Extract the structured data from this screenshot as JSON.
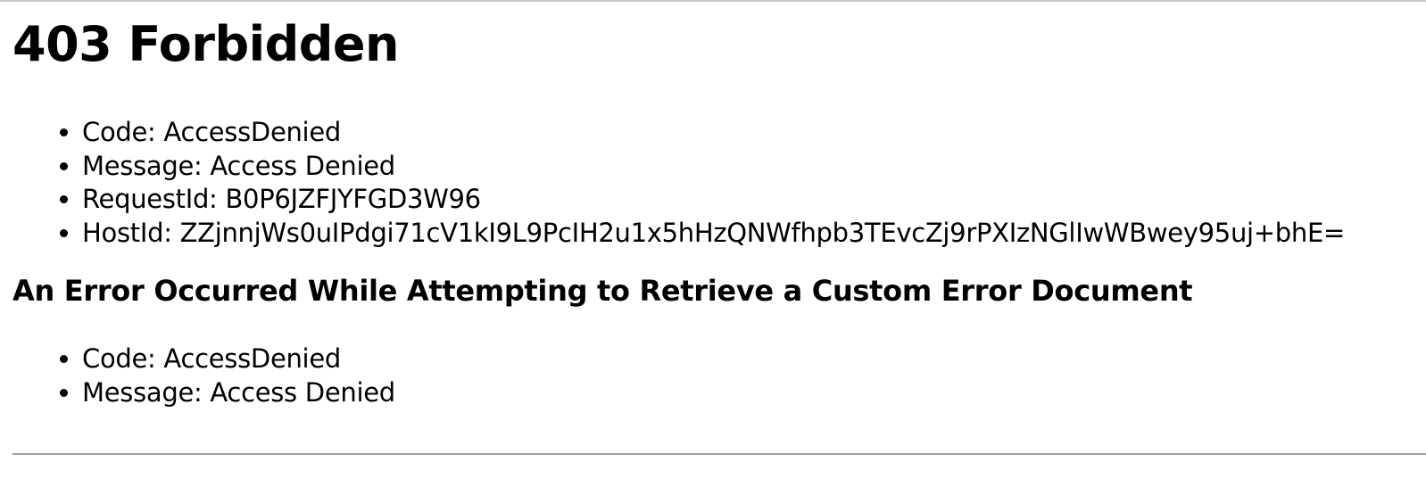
{
  "page": {
    "title": "403 Forbidden"
  },
  "error": {
    "items": [
      {
        "label": "Code",
        "value": "AccessDenied",
        "text": "Code: AccessDenied"
      },
      {
        "label": "Message",
        "value": "Access Denied",
        "text": "Message: Access Denied"
      },
      {
        "label": "RequestId",
        "value": "B0P6JZFJYFGD3W96",
        "text": "RequestId: B0P6JZFJYFGD3W96"
      },
      {
        "label": "HostId",
        "value": "ZZjnnjWs0uIPdgi71cV1kI9L9PcIH2u1x5hHzQNWfhpb3TEvcZj9rPXIzNGlIwWBwey95uj+bhE=",
        "text": "HostId: ZZjnnjWs0uIPdgi71cV1kI9L9PcIH2u1x5hHzQNWfhpb3TEvcZj9rPXIzNGlIwWBwey95uj+bhE="
      }
    ]
  },
  "custom_error": {
    "heading": "An Error Occurred While Attempting to Retrieve a Custom Error Document",
    "items": [
      {
        "label": "Code",
        "value": "AccessDenied",
        "text": "Code: AccessDenied"
      },
      {
        "label": "Message",
        "value": "Access Denied",
        "text": "Message: Access Denied"
      }
    ]
  }
}
